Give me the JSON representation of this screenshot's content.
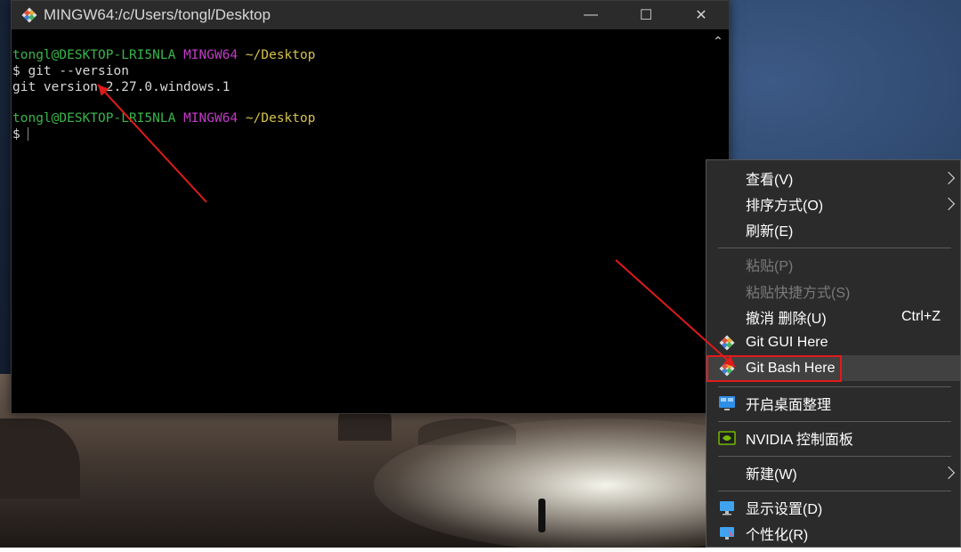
{
  "window": {
    "title": "MINGW64:/c/Users/tongl/Desktop",
    "controls": {
      "minimize": "—",
      "maximize": "☐",
      "close": "✕"
    }
  },
  "terminal": {
    "prompt1": {
      "user": "tongl@DESKTOP-LRI5NLA",
      "env": "MINGW64",
      "path": "~/Desktop"
    },
    "command": "$ git --version",
    "output": "git version 2.27.0.windows.1",
    "prompt2": {
      "user": "tongl@DESKTOP-LRI5NLA",
      "env": "MINGW64",
      "path": "~/Desktop"
    },
    "current": "$"
  },
  "context_menu": {
    "items": [
      {
        "label": "查看(V)",
        "submenu": true
      },
      {
        "label": "排序方式(O)",
        "submenu": true
      },
      {
        "label": "刷新(E)"
      },
      {
        "label": "粘贴(P)",
        "disabled": true
      },
      {
        "label": "粘贴快捷方式(S)",
        "disabled": true
      },
      {
        "label": "撤消 删除(U)",
        "shortcut": "Ctrl+Z"
      },
      {
        "label": "Git GUI Here",
        "icon": "git-icon"
      },
      {
        "label": "Git Bash Here",
        "icon": "git-icon",
        "highlighted": true
      },
      {
        "label": "开启桌面整理",
        "icon": "desktop-organizer-icon"
      },
      {
        "label": "NVIDIA 控制面板",
        "icon": "nvidia-icon"
      },
      {
        "label": "新建(W)",
        "submenu": true
      },
      {
        "label": "显示设置(D)",
        "icon": "display-icon"
      },
      {
        "label": "个性化(R)",
        "icon": "personalize-icon"
      }
    ]
  },
  "colors": {
    "prompt_user": "#39b54a",
    "prompt_env": "#c53ac9",
    "prompt_path": "#d6c24a",
    "highlight_box": "#e01b1b",
    "annotation_arrow": "#e01b1b"
  }
}
